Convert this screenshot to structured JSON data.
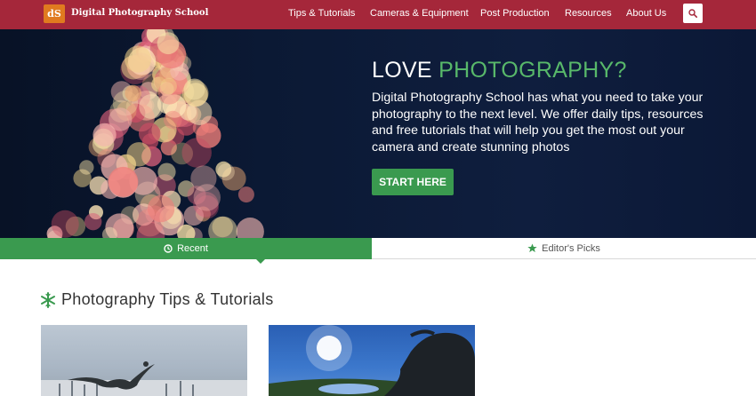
{
  "header": {
    "logo_text": "dS",
    "site_name": "Digital Photography School",
    "nav_items": [
      "Tips & Tutorials",
      "Cameras & Equipment",
      "Post Production",
      "Resources",
      "About Us"
    ]
  },
  "hero": {
    "title_part1": "LOVE",
    "title_part2": "PHOTOGRAPHY?",
    "description": "Digital Photography School has what you need to take your photography to the next level. We offer daily tips, resources and free tutorials that will help you get the most out your camera and create stunning photos",
    "cta_label": "START HERE"
  },
  "tabs": {
    "recent": "Recent",
    "editors_picks": "Editor's Picks"
  },
  "section": {
    "title": "Photography Tips & Tutorials"
  },
  "colors": {
    "topbar": "#a5273a",
    "accent_green": "#3a9a4f",
    "title_green": "#58b86a",
    "hero_bg": "#0b1934"
  }
}
